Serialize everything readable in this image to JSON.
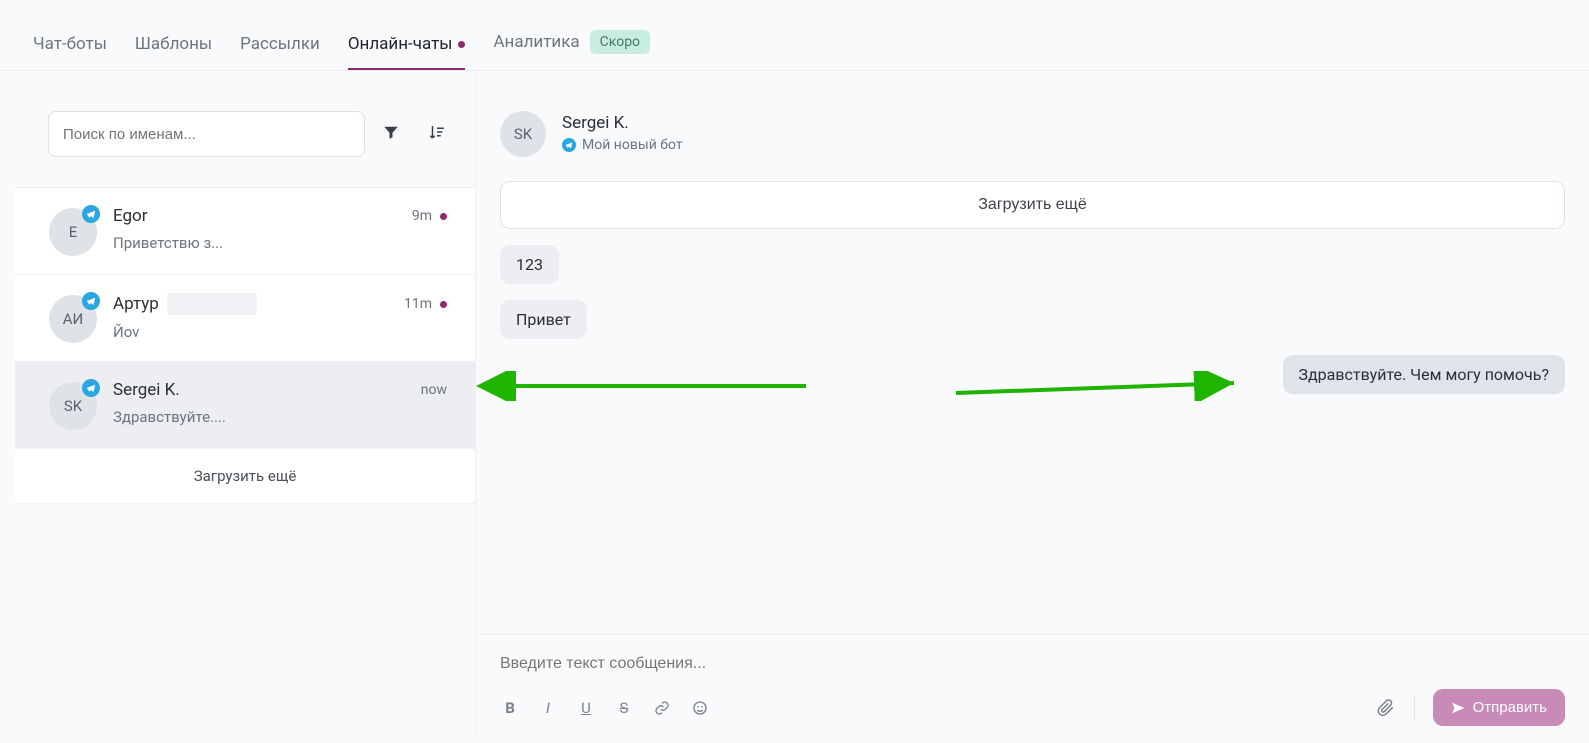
{
  "nav": {
    "tabs": [
      {
        "label": "Чат-боты"
      },
      {
        "label": "Шаблоны"
      },
      {
        "label": "Рассылки"
      },
      {
        "label": "Онлайн-чаты",
        "active": true,
        "has_dot": true
      },
      {
        "label": "Аналитика",
        "badge": "Скоро"
      }
    ]
  },
  "sidebar": {
    "search_placeholder": "Поиск по именам...",
    "load_more_label": "Загрузить ещё",
    "items": [
      {
        "initials": "E",
        "name": "Egor",
        "preview": "Приветствю з...",
        "time": "9m",
        "unread": true
      },
      {
        "initials": "АИ",
        "name": "Артур",
        "preview": "Йov",
        "time": "11m",
        "unread": true,
        "extra_chip": true
      },
      {
        "initials": "SK",
        "name": "Sergei K.",
        "preview": "Здравствуйте....",
        "time": "now",
        "selected": true
      }
    ]
  },
  "chat": {
    "header": {
      "initials": "SK",
      "name": "Sergei K.",
      "bot_name": "Мой новый бот"
    },
    "load_more_label": "Загрузить ещё",
    "messages": [
      {
        "side": "in",
        "text": "123"
      },
      {
        "side": "in",
        "text": "Привет"
      },
      {
        "side": "out",
        "text": "Здравствуйте. Чем могу помочь?"
      }
    ],
    "composer_placeholder": "Введите текст сообщения...",
    "send_label": "Отправить"
  },
  "colors": {
    "accent": "#8e2a6b",
    "telegram": "#2aa7e0",
    "send_button": "#c88ab6",
    "badge_soon_bg": "#c9ece1"
  }
}
